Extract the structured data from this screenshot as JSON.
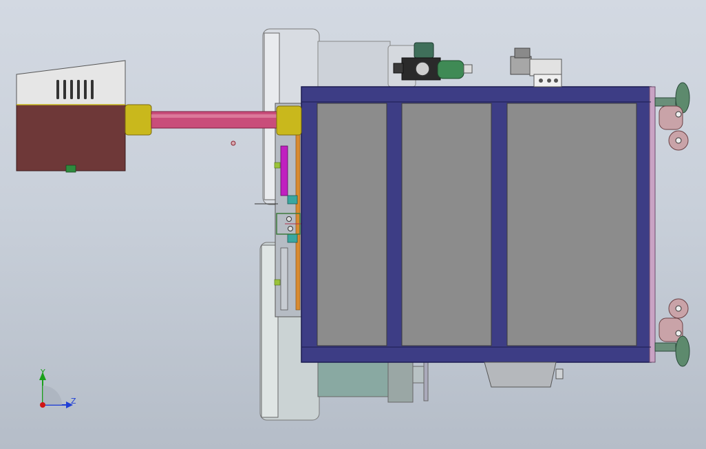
{
  "triad": {
    "y_label": "Y",
    "z_label": "Z",
    "y_color": "#1aa01a",
    "z_color": "#1f3fd6",
    "x_color": "#d01515"
  },
  "colors": {
    "background_top": "#d3d9e2",
    "background_bottom": "#b5bdc8",
    "frame_blue": "#3d3d85",
    "panel_grey": "#8c8c8c",
    "motor_body": "#6e3838",
    "motor_cover": "#e6e6e6",
    "coupling_yellow": "#c9b81c",
    "shaft_pink": "#c94d7a",
    "valve_green": "#3f8a55",
    "caster_pink": "#c9a3a8",
    "wheel_green": "#5d8a6d",
    "disc_grey": "#d8dce2",
    "magenta_part": "#c020c0",
    "orange_strip": "#d88a30",
    "teal_part": "#3aa7a0"
  }
}
